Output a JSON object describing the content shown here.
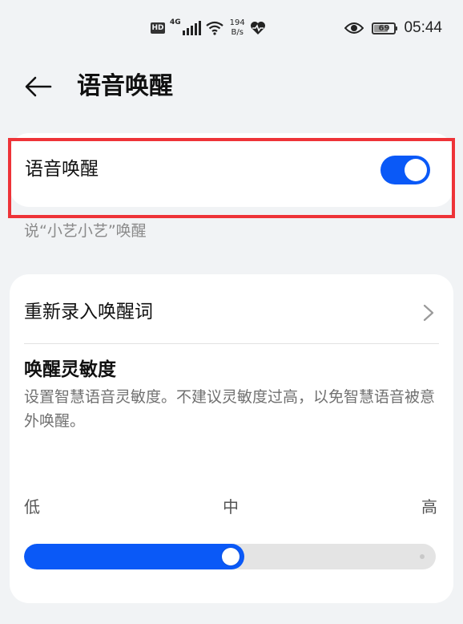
{
  "status_bar": {
    "hd": "HD",
    "network": "4G",
    "speed_value": "194",
    "speed_unit": "B/s",
    "battery": "69",
    "time": "05:44"
  },
  "header": {
    "back_icon": "back-arrow-icon",
    "title": "语音唤醒"
  },
  "voice_wake": {
    "label": "语音唤醒",
    "enabled": true,
    "hint": "说“小艺小艺”唤醒"
  },
  "settings_card": {
    "rerecord_label": "重新录入唤醒词",
    "sensitivity_title": "唤醒灵敏度",
    "sensitivity_desc": "设置智慧语音灵敏度。不建议灵敏度过高，以免智慧语音被意外唤醒。",
    "levels": {
      "low": "低",
      "mid": "中",
      "high": "高"
    },
    "slider_value_fraction": 0.5
  },
  "colors": {
    "accent": "#0a59f7",
    "highlight": "#ee3338",
    "background": "#f1f3f5"
  }
}
